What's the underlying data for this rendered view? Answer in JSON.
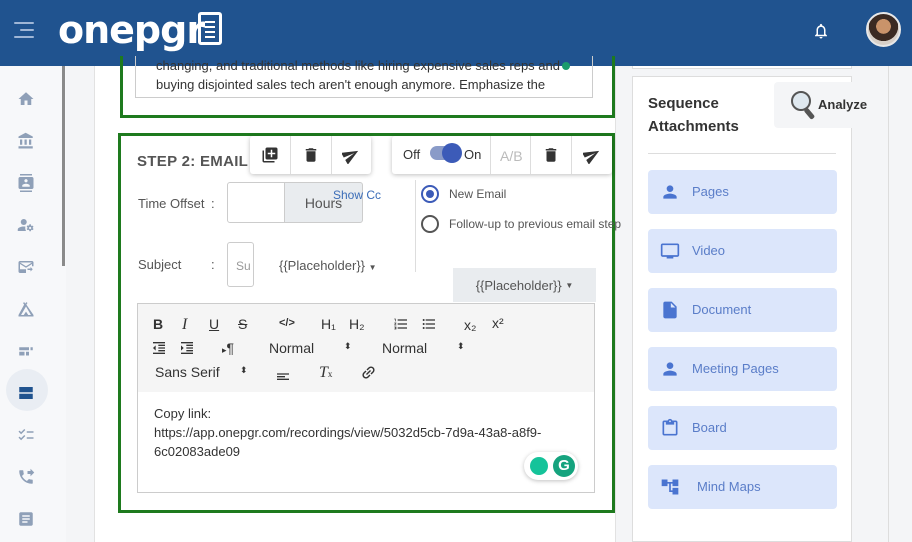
{
  "header": {
    "logo": "onepgr"
  },
  "sidebar": {
    "items": [
      "home-icon",
      "bank-icon",
      "contacts-icon",
      "user-settings-icon",
      "email-forward-icon",
      "camp-icon",
      "dashboard-icon",
      "sequence-icon",
      "checklist-icon",
      "phone-forward-icon",
      "notes-icon"
    ],
    "active_index": 7
  },
  "prev_step": {
    "text_line1": "changing, and traditional methods like hiring expensive sales reps and",
    "text_line2": "buying disjointed sales tech aren't enough anymore. Emphasize the"
  },
  "step": {
    "title": "STEP 2: EMAIL",
    "toggle_off": "Off",
    "toggle_on": "On",
    "ab_label": "A/B",
    "time_offset_label": "Time Offset",
    "colon": ":",
    "time_offset_value": "",
    "hours_label": "Hours",
    "show_cc": "Show Cc",
    "subject_label": "Subject",
    "subject_placeholder": "Su",
    "placeholder_btn": "{{Placeholder}}",
    "placeholder_btn2": "{{Placeholder}}",
    "radio_new": "New Email",
    "radio_follow": "Follow-up to previous email step"
  },
  "editor_toolbar": {
    "bold": "B",
    "italic": "I",
    "underline": "U",
    "strike": "S",
    "code": "</>",
    "h1": "H₁",
    "h2": "H₂",
    "sub": "x₂",
    "sup": "x²",
    "pilcrow": "¶",
    "size1": "Normal",
    "size2": "Normal",
    "font": "Sans Serif"
  },
  "editor": {
    "line1": "Copy link:",
    "line2": "https://app.onepgr.com/recordings/view/5032d5cb-7d9a-43a8-a8f9-",
    "line3": "6c02083ade09"
  },
  "attachments": {
    "title_line1": "Sequence",
    "title_line2": "Attachments",
    "analyze": "Analyze",
    "items": [
      {
        "label": "Pages",
        "icon": "person-icon"
      },
      {
        "label": "Video",
        "icon": "monitor-icon"
      },
      {
        "label": "Document",
        "icon": "document-icon"
      },
      {
        "label": "Meeting Pages",
        "icon": "person-icon"
      },
      {
        "label": "Board",
        "icon": "clipboard-icon"
      },
      {
        "label": "Mind Maps",
        "icon": "mindmap-icon"
      }
    ]
  },
  "colors": {
    "header": "#20538f",
    "green_border": "#1e7a1e",
    "accent": "#3c5bb8",
    "attachment_bg": "#dce6fb"
  }
}
